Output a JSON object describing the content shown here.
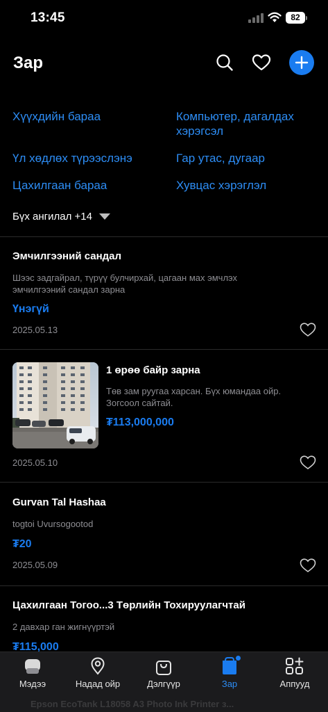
{
  "status": {
    "time": "13:45",
    "battery": "82"
  },
  "header": {
    "title": "Зар"
  },
  "categories": [
    "Хүүхдийн бараа",
    "Компьютер, дагалдах хэрэгсэл",
    "Үл хөдлөх түрээслэнэ",
    "Гар утас, дугаар",
    "Цахилгаан бараа",
    "Хувцас хэрэглэл"
  ],
  "all_categories_label": "Бүх ангилал +14",
  "listings": [
    {
      "title": "Эмчилгээний сандал",
      "description": "Шээс задгайрал, түрүү булчирхай, цагаан мах эмчлэх эмчилгээний сандал зарна",
      "price": "Үнэгүй",
      "date": "2025.05.13"
    },
    {
      "title": "1 өрөө байр зарна",
      "description": "Төв зам руугаа харсан. Бүх юмандаа ойр. Зогсоол сайтай.",
      "price": "₮113,000,000",
      "date": "2025.05.10"
    },
    {
      "title": "Gurvan Tal Hashaa",
      "description": "togtoi Uvursogootod",
      "price": "₮20",
      "date": "2025.05.09"
    },
    {
      "title": "Цахилгаан Тогоо...3 Төрлийн Тохируулагчтай",
      "description": "2 давхар ган жигнүүртэй",
      "price": "₮115,000"
    }
  ],
  "peek_text": "Epson EcoTank L18058 A3 Photo Ink Printer з...",
  "tabs": [
    {
      "label": "Мэдээ",
      "icon": "news-icon"
    },
    {
      "label": "Надад ойр",
      "icon": "location-pin-icon"
    },
    {
      "label": "Дэлгүүр",
      "icon": "shopping-bag-icon"
    },
    {
      "label": "Зар",
      "icon": "ads-icon"
    },
    {
      "label": "Аппууд",
      "icon": "apps-grid-icon"
    }
  ],
  "colors": {
    "accent": "#1a7cf0",
    "link": "#2d8df5",
    "background": "#000000",
    "muted": "#8e8e93"
  }
}
